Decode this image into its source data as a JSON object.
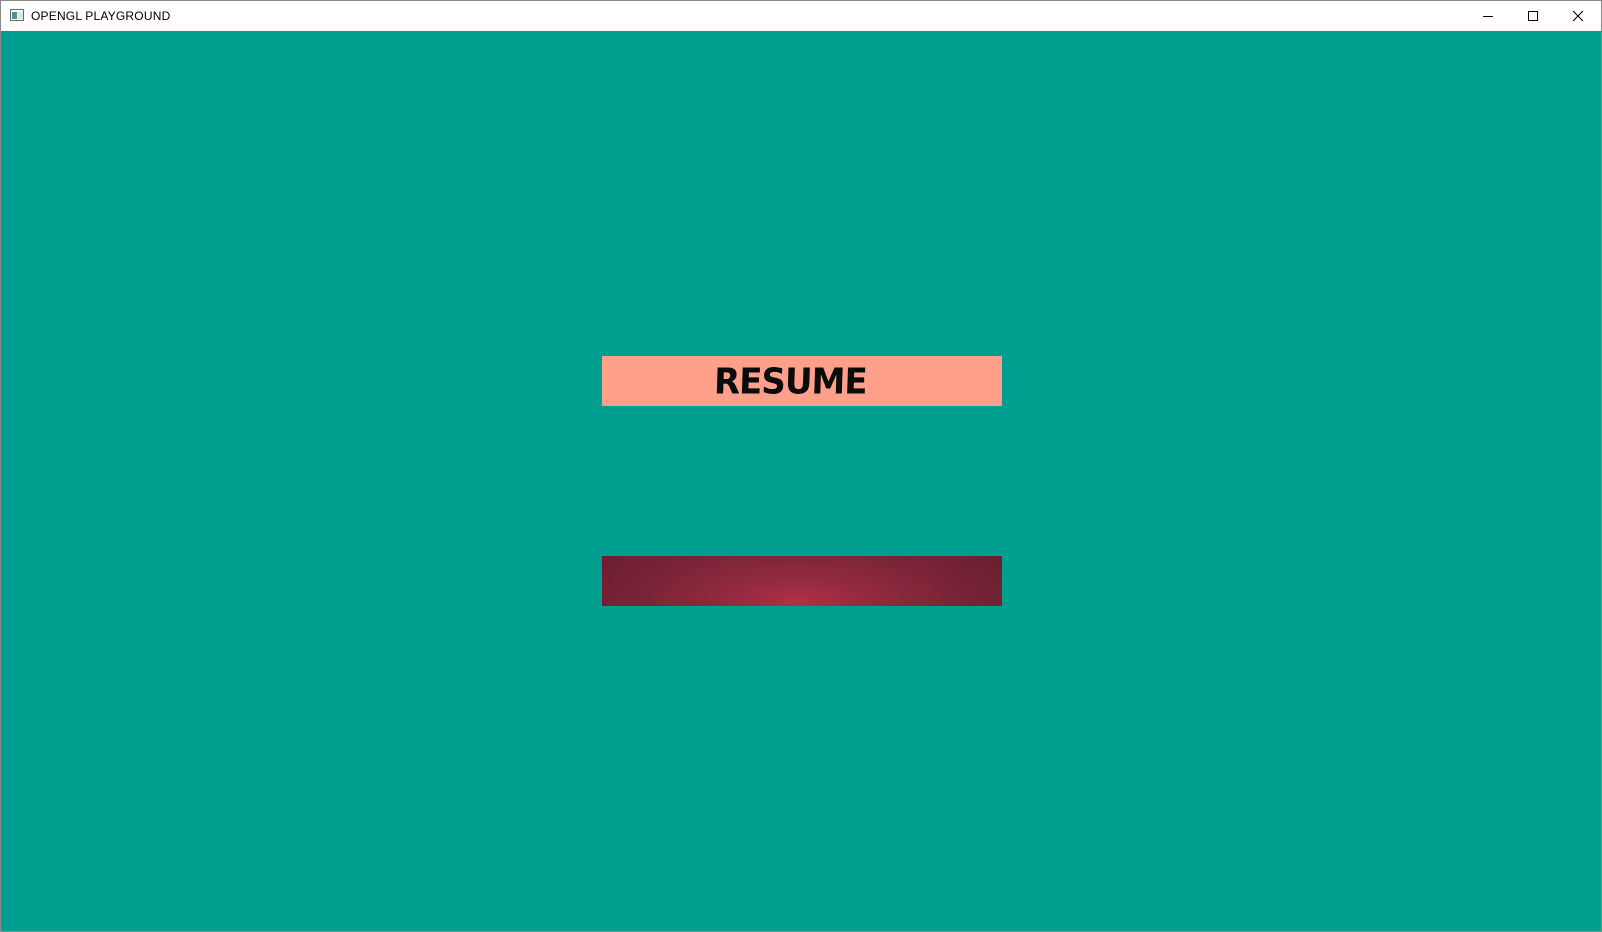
{
  "window": {
    "title": "OPENGL PLAYGROUND",
    "app_icon": "app-window-icon",
    "controls": {
      "minimize_icon": "minimize-icon",
      "maximize_icon": "maximize-icon",
      "close_icon": "close-icon"
    }
  },
  "scene": {
    "background_color": "#009e8f",
    "menu": {
      "resume_label": "RESUME",
      "resume_color": "#ffa08a",
      "second_button_label": "",
      "second_button_color": "#7a2436"
    }
  }
}
